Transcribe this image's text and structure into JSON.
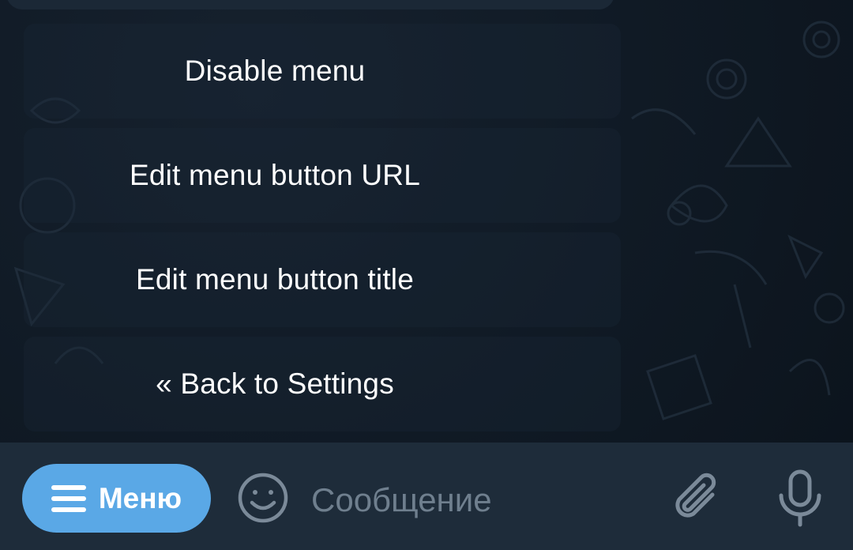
{
  "keyboard": {
    "buttons": [
      {
        "label": "Disable menu"
      },
      {
        "label": "Edit menu button URL"
      },
      {
        "label": "Edit menu button title"
      },
      {
        "label": "« Back to Settings"
      }
    ]
  },
  "input_bar": {
    "menu_button_label": "Меню",
    "menu_icon": "hamburger-icon",
    "emoji_icon": "emoji-icon",
    "message_placeholder": "Сообщение",
    "attach_icon": "paperclip-icon",
    "mic_icon": "microphone-icon"
  },
  "colors": {
    "background": "#0f1823",
    "input_bar": "#1e2c3a",
    "menu_button": "#5aa8e6",
    "icon_gray": "#7b8a99",
    "placeholder": "#6f7f8e"
  }
}
